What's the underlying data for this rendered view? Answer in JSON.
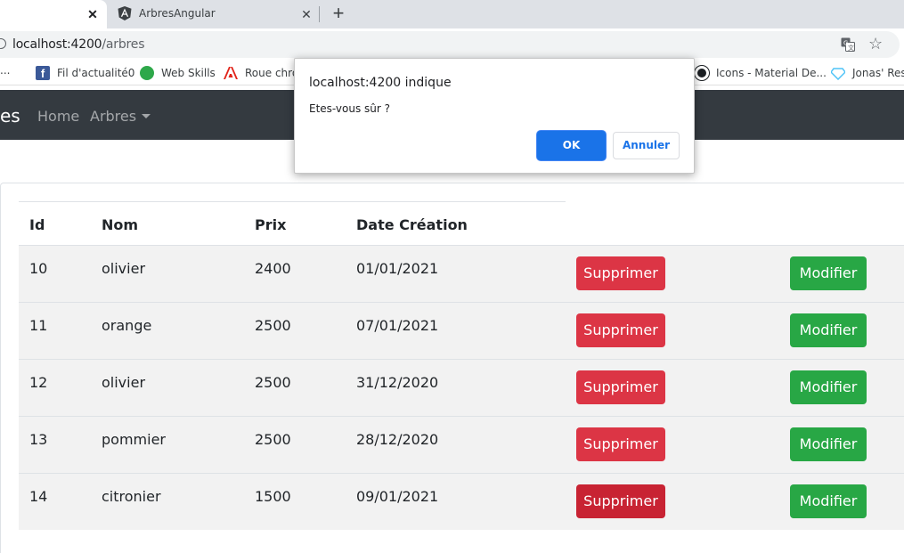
{
  "browser": {
    "tabs": [
      {
        "title": ""
      },
      {
        "title": "ArbresAngular"
      }
    ],
    "url_host": "localhost:4200",
    "url_path": "/arbres",
    "bookmarks": [
      {
        "label": "Fil d'actualité0",
        "icon": "facebook-icon"
      },
      {
        "label": "Web Skills",
        "icon": "brain-icon"
      },
      {
        "label": "Roue chron",
        "icon": "adobe-icon"
      },
      {
        "label": "Icons - Material De...",
        "icon": "github-icon"
      },
      {
        "label": "Jonas' Reso",
        "icon": "diamond-icon"
      }
    ],
    "bookmarks_overflow": "..."
  },
  "navbar": {
    "brand": "es",
    "home": "Home",
    "arbres": "Arbres"
  },
  "table": {
    "headers": [
      "Id",
      "Nom",
      "Prix",
      "Date Création"
    ],
    "rows": [
      {
        "id": "10",
        "nom": "olivier",
        "prix": "2400",
        "date": "01/01/2021"
      },
      {
        "id": "11",
        "nom": "orange",
        "prix": "2500",
        "date": "07/01/2021"
      },
      {
        "id": "12",
        "nom": "olivier",
        "prix": "2500",
        "date": "31/12/2020"
      },
      {
        "id": "13",
        "nom": "pommier",
        "prix": "2500",
        "date": "28/12/2020"
      },
      {
        "id": "14",
        "nom": "citronier",
        "prix": "1500",
        "date": "09/01/2021"
      }
    ],
    "delete_label": "Supprimer",
    "edit_label": "Modifier"
  },
  "dialog": {
    "title": "localhost:4200 indique",
    "message": "Etes-vous sûr ?",
    "ok": "OK",
    "cancel": "Annuler"
  },
  "colors": {
    "danger": "#dc3545",
    "success": "#28a745",
    "navbar": "#343a40",
    "dialog_primary": "#1a73e8"
  }
}
